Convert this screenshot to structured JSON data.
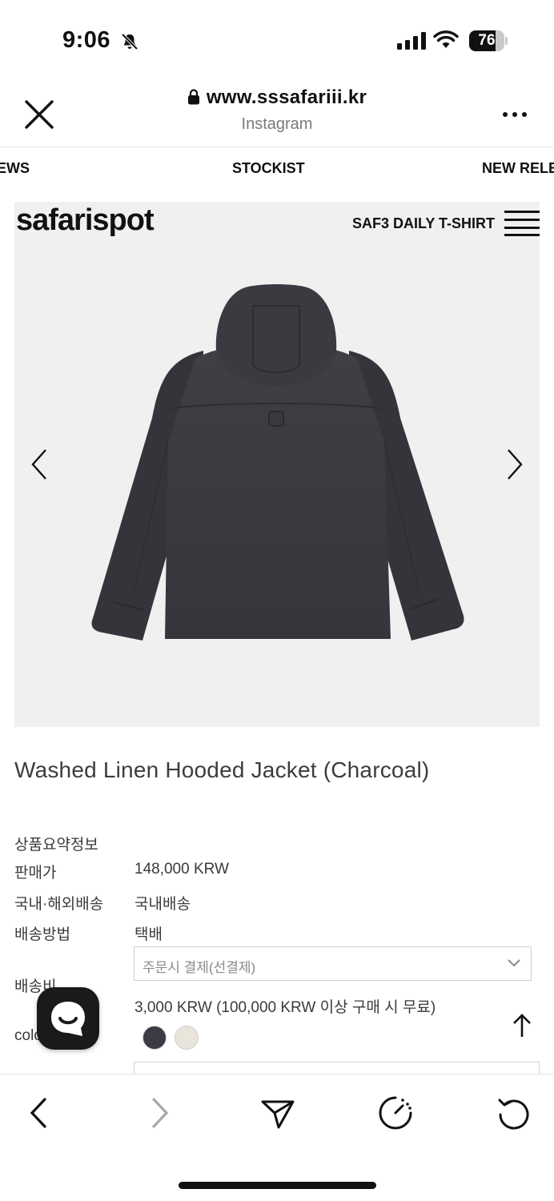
{
  "status_bar": {
    "time": "9:06",
    "battery_level": "76",
    "battery_fraction": 0.76,
    "icons": [
      "bell-slash-icon",
      "signal-icon",
      "wifi-icon",
      "battery-icon"
    ]
  },
  "browser": {
    "url": "www.sssafariii.kr",
    "source": "Instagram",
    "icons": [
      "close-icon",
      "lock-icon",
      "more-icon"
    ]
  },
  "site_nav": {
    "items": [
      "EWS",
      "STOCKIST",
      "NEW RELE"
    ]
  },
  "header": {
    "brand": "safarispot",
    "menu_label": "SAF3 DAILY T-SHIRT"
  },
  "product": {
    "title": "Washed Linen Hooded Jacket (Charcoal)",
    "image_description_icon": "jacket-image",
    "info": {
      "summary_label": "상품요약정보",
      "price_label": "판매가",
      "price_value": "148,000 KRW",
      "domestic_label": "국내·해외배송",
      "domestic_value": "국내배송",
      "method_label": "배송방법",
      "method_value": "택배",
      "shipping_select": "주문시 결제(선결제)",
      "fee_label": "배송비",
      "fee_value": "3,000 KRW (100,000 KRW 이상 구매 시 무료)",
      "color_label": "color"
    },
    "swatches": [
      {
        "name": "charcoal",
        "color": "#3a3b45"
      },
      {
        "name": "ivory",
        "color": "#e9e5da"
      }
    ]
  },
  "colors": {
    "image_bg": "#f0f0f0",
    "jacket": "#3b3b40",
    "text": "#3a3a3a"
  },
  "toolbar": {
    "icons": [
      "back-icon",
      "forward-icon",
      "share-icon",
      "speed-icon",
      "reload-icon"
    ]
  }
}
